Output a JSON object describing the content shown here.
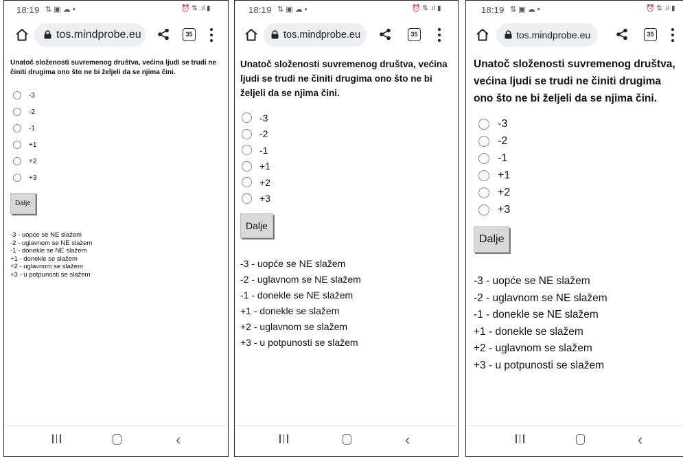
{
  "status": {
    "time": "18:19",
    "left_icons": "⇅ ▣ ☁ •",
    "right_icons": "⏰ ⇅ .ıl ▮"
  },
  "browser": {
    "url": "tos.mindprobe.eu",
    "tab_count": "35"
  },
  "survey": {
    "question": "Unatoč složenosti suvremenog društva, većina ljudi se trudi ne činiti drugima ono što ne bi željeli da se njima čini.",
    "options": [
      "-3",
      "-2",
      "-1",
      "+1",
      "+2",
      "+3"
    ],
    "button_label": "Dalje",
    "legend": [
      "-3 - uopće se NE slažem",
      "-2 - uglavnom se NE slažem",
      "-1 - donekle se NE slažem",
      "+1 - donekle se slažem",
      "+2 - uglavnom se slažem",
      "+3 - u potpunosti se slažem"
    ]
  }
}
